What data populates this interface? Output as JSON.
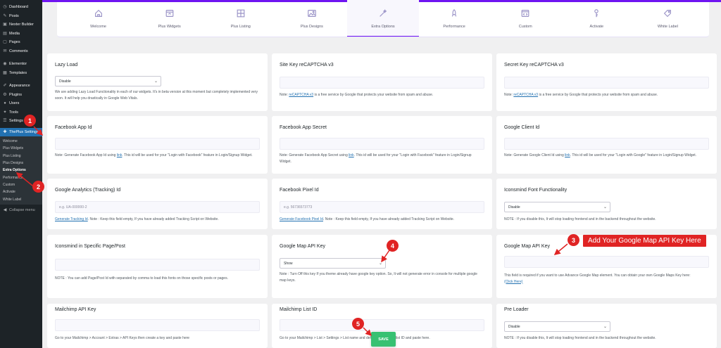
{
  "sidebar": {
    "top_items": [
      {
        "icon": "dashboard-icon",
        "label": "Dashboard"
      },
      {
        "icon": "pin-icon",
        "label": "Posts"
      },
      {
        "icon": "builder-icon",
        "label": "Nexter Builder"
      },
      {
        "icon": "media-icon",
        "label": "Media"
      },
      {
        "icon": "page-icon",
        "label": "Pages"
      },
      {
        "icon": "comment-icon",
        "label": "Comments"
      }
    ],
    "mid_items": [
      {
        "icon": "elementor-icon",
        "label": "Elementor"
      },
      {
        "icon": "folder-icon",
        "label": "Templates"
      }
    ],
    "lower_items": [
      {
        "icon": "brush-icon",
        "label": "Appearance"
      },
      {
        "icon": "plugin-icon",
        "label": "Plugins"
      },
      {
        "icon": "user-icon",
        "label": "Users"
      },
      {
        "icon": "wrench-icon",
        "label": "Tools"
      },
      {
        "icon": "settings-icon",
        "label": "Settings"
      }
    ],
    "active_item": {
      "icon": "theplus-icon",
      "label": "ThePlus Settings"
    },
    "submenu": [
      "Welcome",
      "Plus Widgets",
      "Plus Listing",
      "Plus Designs",
      "Extra Options",
      "Performance",
      "Custom",
      "Activate",
      "White Label"
    ],
    "submenu_current": "Extra Options",
    "collapse_label": "Collapse menu"
  },
  "tabs": [
    {
      "label": "Welcome",
      "icon": "home-icon"
    },
    {
      "label": "Plus Widgets",
      "icon": "widgets-icon"
    },
    {
      "label": "Plus Listing",
      "icon": "grid-icon"
    },
    {
      "label": "Plus Designs",
      "icon": "image-icon"
    },
    {
      "label": "Extra Options",
      "icon": "magic-wand-icon",
      "active": true
    },
    {
      "label": "Performance",
      "icon": "rocket-icon"
    },
    {
      "label": "Custom",
      "icon": "code-icon"
    },
    {
      "label": "Activate",
      "icon": "key-icon"
    },
    {
      "label": "White Label",
      "icon": "tag-icon"
    }
  ],
  "cards": {
    "lazy_load": {
      "title": "Lazy Load",
      "select": "Disable",
      "note": "We are adding Lazy Load Functionality in each of our widgets. It's in beta version at this moment but completely implemented very soon. It will help you drastically in Google Web Vitals."
    },
    "site_key": {
      "title": "Site Key reCAPTCHA v3",
      "note_pre": "Note: ",
      "link": "reCAPTCHA v3",
      "note_post": " is a free service by Google that protects your website from spam and abuse."
    },
    "secret_key": {
      "title": "Secret Key reCAPTCHA v3",
      "note_pre": "Note: ",
      "link": "reCAPTCHA v3",
      "note_post": " is a free service by Google that protects your website from spam and abuse."
    },
    "fb_app_id": {
      "title": "Facebook App Id",
      "note_pre": "Note: Generate Facebook App Id using ",
      "link": "link",
      "note_post": ". This id will be used for your \"Login with Facebook\" feature in Login/Signup Widget."
    },
    "fb_app_secret": {
      "title": "Facebook App Secret",
      "note_pre": "Note: Generate Facebook App Secret using ",
      "link": "link",
      "note_post": ". This id will be used for your \"Login with Facebook\" feature in Login/Signup Widget."
    },
    "google_client_id": {
      "title": "Google Client Id",
      "note_pre": "Note: Generate Google Client Id using ",
      "link": "link",
      "note_post": ". This id will be used for your \"Login with Google\" feature in Login/Signup Widget."
    },
    "ga_id": {
      "title": "Google Analytics (Tracking) Id",
      "placeholder": "e.g. UA-000000-2",
      "link": "Generate Tracking Id",
      "note_post": ". Note : Keep this field empty, If you have already added Tracking Script on Website."
    },
    "fb_pixel": {
      "title": "Facebook Pixel Id",
      "placeholder": "e.g. 56736573773",
      "link": "Generate Facebook Pixel Id",
      "note_post": ". Note : Keep this field empty, If you have already added Tracking Script on Website."
    },
    "iconsmind_font": {
      "title": "Iconsmind Font Functionality",
      "select": "Disable",
      "note": "NOTE : If you disable this, It will stop loading frontend and in the backend throughout the website."
    },
    "iconsmind_pages": {
      "title": "Iconsmind in Specific Page/Post",
      "note": "NOTE : You can add Page/Post Id with separated by comma to load this fonts on those specific posts or pages."
    },
    "gmap_toggle": {
      "title": "Google Map API Key",
      "select": "Show",
      "note": "Note : Turn Off this key If you theme already have google key option. So, It will not generate error in console for multiple google map keys."
    },
    "gmap_key": {
      "title": "Google Map API Key",
      "note": "This field is required if you want to use Advance Google Map element. You can obtain your own Google Maps Key here:",
      "link": "(Click Here)"
    },
    "mailchimp_key": {
      "title": "Mailchimp API Key",
      "note": "Go to your Mailchimp > Account > Extras > API Keys then create a key and paste here"
    },
    "mailchimp_list": {
      "title": "Mailchimp List ID",
      "note": "Go to your Mailchimp > List > Settings > List name and default > Copy the list ID and paste here."
    },
    "preloader": {
      "title": "Pre Loader",
      "select": "Disable",
      "note": "NOTE : If you disable this, It will stop loading frontend and in the backend throughout the website."
    }
  },
  "callouts": {
    "b1": "1",
    "b2": "2",
    "b3": "3",
    "b4": "4",
    "b5": "5",
    "label3": "Add Your Google Map API Key Here",
    "color": "#e02424"
  },
  "save_label": "SAVE",
  "colors": {
    "accent": "#6f14f1",
    "wp_active": "#2271b1",
    "save": "#37c172"
  }
}
